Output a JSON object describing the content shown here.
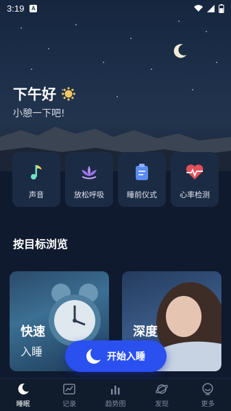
{
  "status": {
    "time": "3:19"
  },
  "greeting": {
    "title": "下午好",
    "subtitle": "小憩一下吧!"
  },
  "quick_actions": [
    {
      "label": "声音",
      "icon": "music-note-icon"
    },
    {
      "label": "放松呼吸",
      "icon": "lotus-icon"
    },
    {
      "label": "睡前仪式",
      "icon": "clipboard-icon"
    },
    {
      "label": "心率检测",
      "icon": "heart-pulse-icon"
    }
  ],
  "section": {
    "title": "按目标浏览"
  },
  "cards": [
    {
      "title1": "快速",
      "title2": "入睡"
    },
    {
      "title1": "深度",
      "title2": ""
    }
  ],
  "start_button": {
    "label": "开始入睡"
  },
  "tabs": [
    {
      "label": "睡眠",
      "icon": "moon-icon",
      "active": true
    },
    {
      "label": "记录",
      "icon": "chart-record-icon",
      "active": false
    },
    {
      "label": "趋势图",
      "icon": "bar-chart-icon",
      "active": false
    },
    {
      "label": "发现",
      "icon": "planet-icon",
      "active": false
    },
    {
      "label": "更多",
      "icon": "more-icon",
      "active": false
    }
  ],
  "colors": {
    "accent": "#2a50f0",
    "background": "#0f1a2e",
    "card": "#1c2b44"
  }
}
